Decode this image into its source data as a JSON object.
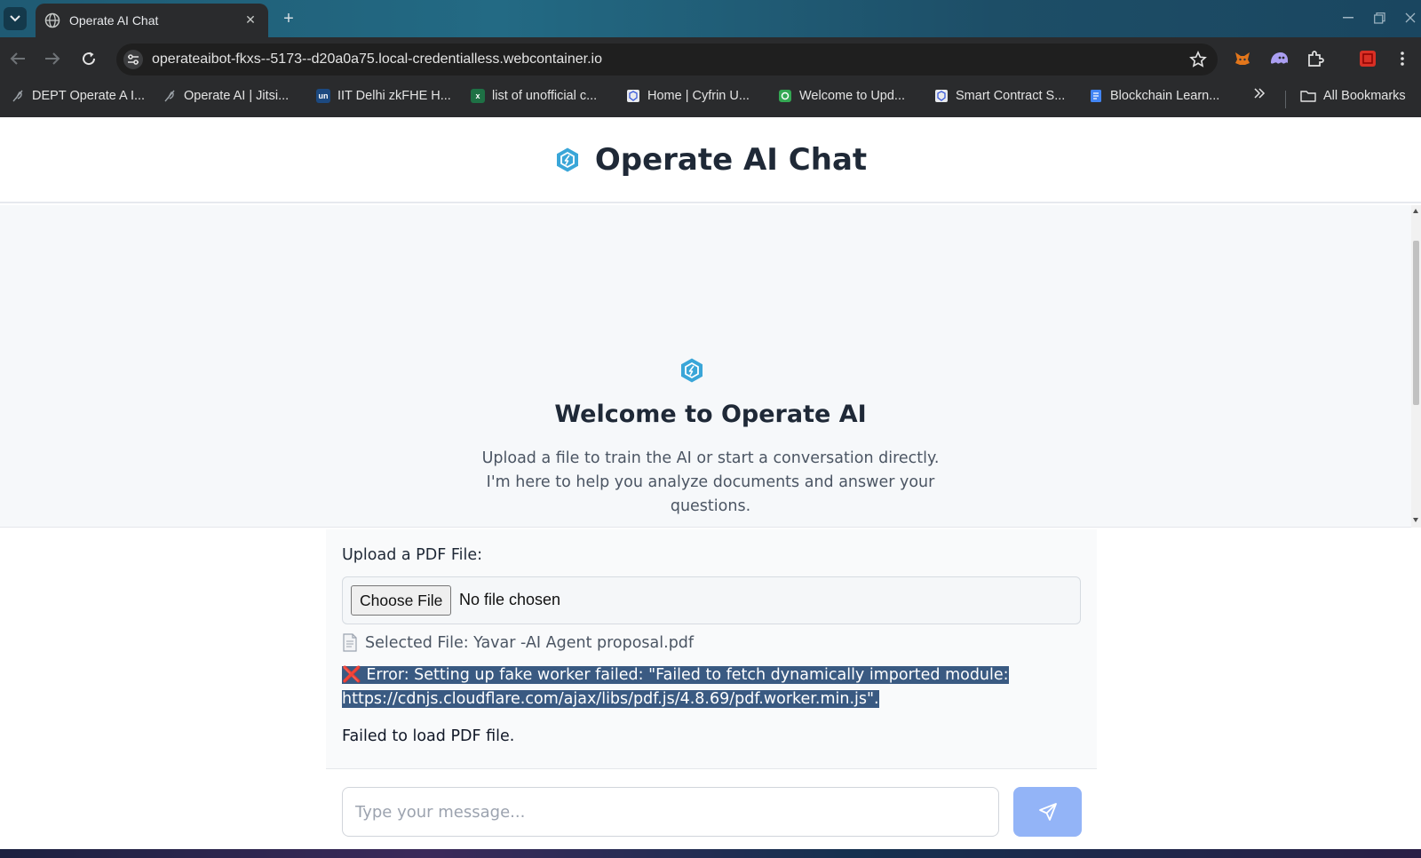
{
  "browser": {
    "tab_title": "Operate AI Chat",
    "url": "operateaibot-fkxs--5173--d20a0a75.local-credentialless.webcontainer.io",
    "bookmarks": [
      {
        "label": "DEPT Operate A I...",
        "icon": "feather-icon",
        "color": "#9aa0a6"
      },
      {
        "label": "Operate AI | Jitsi...",
        "icon": "feather-icon",
        "color": "#9aa0a6"
      },
      {
        "label": "IIT Delhi zkFHE H...",
        "icon": "unstop-icon",
        "color": "#1c4980"
      },
      {
        "label": "list of unofficial c...",
        "icon": "excel-icon",
        "color": "#1e7145"
      },
      {
        "label": "Home | Cyfrin U...",
        "icon": "cyfrin-icon",
        "color": "#e8eaed"
      },
      {
        "label": "Welcome to Upd...",
        "icon": "updraft-icon",
        "color": "#34a853"
      },
      {
        "label": "Smart Contract S...",
        "icon": "cyfrin-icon",
        "color": "#e8eaed"
      },
      {
        "label": "Blockchain Learn...",
        "icon": "docs-icon",
        "color": "#4285f4"
      }
    ],
    "all_bookmarks": "All Bookmarks"
  },
  "app": {
    "title": "Operate AI Chat",
    "welcome_title": "Welcome to Operate AI",
    "welcome_text": "Upload a file to train the AI or start a conversation directly. I'm here to help you analyze documents and answer your questions.",
    "upload_label": "Upload a PDF File:",
    "choose_file": "Choose File",
    "no_file": "No file chosen",
    "selected_file": "Selected File: Yavar -AI Agent proposal.pdf",
    "error_mark": "❌",
    "error_text": "Error: Setting up fake worker failed: \"Failed to fetch dynamically imported module: https://cdnjs.cloudflare.com/ajax/libs/pdf.js/4.8.69/pdf.worker.min.js\".",
    "failed_text": "Failed to load PDF file.",
    "message_placeholder": "Type your message...",
    "accent_color": "#3aa6d8",
    "send_color": "#93b4f7",
    "error_highlight": "#3a5a82"
  }
}
